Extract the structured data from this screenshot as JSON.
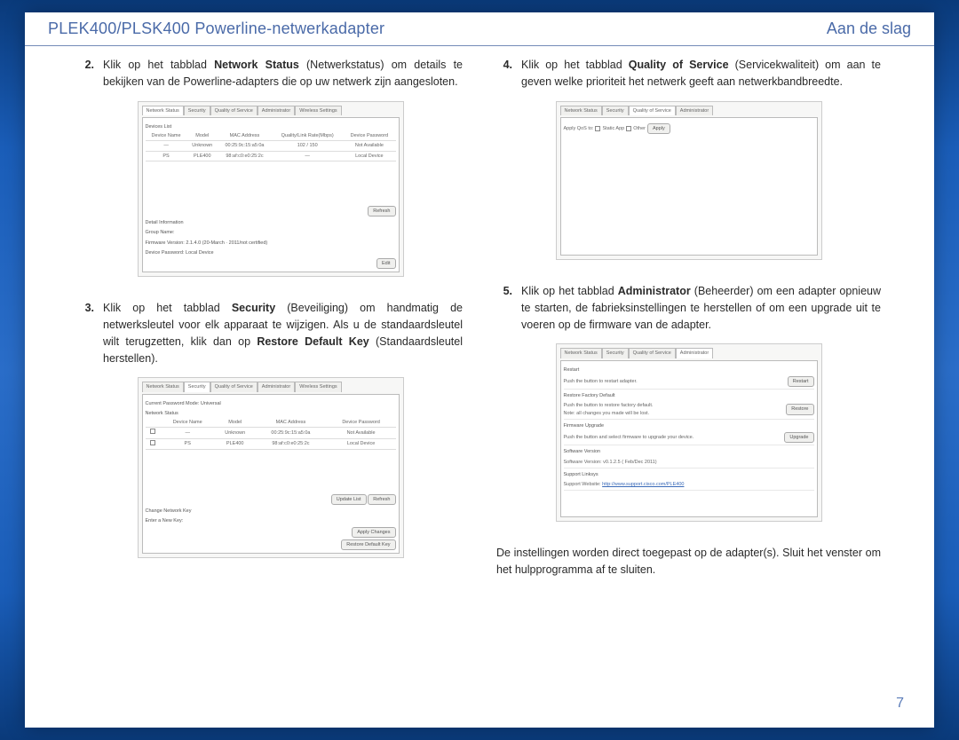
{
  "header": {
    "title": "PLEK400/PLSK400 Powerline-netwerkadapter",
    "section": "Aan de slag"
  },
  "page_number": "7",
  "steps": {
    "s2": {
      "num": "2.",
      "pre": "Klik op het tabblad ",
      "bold": "Network Status",
      "post": " (Netwerkstatus) om details te bekijken van de Powerline-adapters die op uw netwerk zijn aangesloten."
    },
    "s3": {
      "num": "3.",
      "pre": "Klik op het tabblad ",
      "bold": "Security",
      "mid": " (Beveiliging) om handmatig de netwerksleutel voor elk apparaat te wijzigen. Als u de standaardsleutel wilt terugzetten, klik dan op ",
      "bold2": "Restore Default Key",
      "post": " (Standaardsleutel herstellen)."
    },
    "s4": {
      "num": "4.",
      "pre": "Klik op het tabblad ",
      "bold": "Quality of Service",
      "post": " (Servicekwaliteit) om aan te geven welke prioriteit het netwerk geeft aan netwerkbandbreedte."
    },
    "s5": {
      "num": "5.",
      "pre": "Klik op het tabblad ",
      "bold": "Administrator",
      "post": " (Beheerder) om een adapter opnieuw te starten, de fabrieksinstellingen te herstellen of om een upgrade uit te voeren op de firmware van de adapter."
    }
  },
  "closing": "De instellingen worden direct toegepast op de adapter(s). Sluit het venster om het hulpprogramma af te sluiten.",
  "shots": {
    "common_tabs": [
      "Network Status",
      "Security",
      "Quality of Service",
      "Administrator",
      "Wireless Settings"
    ],
    "shot1": {
      "subtitle": "Devices List",
      "headers": [
        "Device Name",
        "Model",
        "MAC Address",
        "Quality/Link Rate(Mbps)",
        "Device Password"
      ],
      "rows": [
        [
          "—",
          "Unknown",
          "00:25:9c:15:a5:0a",
          "102 / 150",
          "Not Available"
        ],
        [
          "PS",
          "PLE400",
          "98:af:c0:e0:25:2c",
          "—",
          "Local Device"
        ]
      ],
      "refresh": "Refresh",
      "info_title": "Detail Information",
      "group": "Group Name:",
      "fw": "Firmware Version:   2.1.4.0 (20-March · 2011/not certified)",
      "pw": "Device Password:   Local Device",
      "edit": "Edit"
    },
    "shot3": {
      "cur": "Current Password Mode:   Universal",
      "status": "Network Status",
      "headers": [
        "",
        "Device Name",
        "Model",
        "MAC Address",
        "Device Password"
      ],
      "rows": [
        [
          "",
          "—",
          "Unknown",
          "00:25:9c:15:a5:0a",
          "Not Available"
        ],
        [
          "",
          "PS",
          "PLE400",
          "98:af:c0:e0:25:2c",
          "Local Device"
        ]
      ],
      "btns": {
        "update": "Update List",
        "refresh": "Refresh"
      },
      "change": "Change Network Key",
      "enter": "Enter a New Key:",
      "apply": "Apply Changes",
      "restore": "Restore Default Key"
    },
    "shot4": {
      "apply_qos": "Apply QoS to:",
      "opt1": "Static App",
      "opt2": "Other",
      "apply": "Apply"
    },
    "shot5": {
      "sections": {
        "restart": {
          "title": "Restart",
          "desc": "Push the button to restart adapter.",
          "btn": "Restart"
        },
        "factory": {
          "title": "Restore Factory Default",
          "desc": "Push the button to restore factory default.\nNote: all changes you made will be lost.",
          "btn": "Restore"
        },
        "fw": {
          "title": "Firmware Upgrade",
          "desc": "Push the button and select firmware to upgrade your device.",
          "btn": "Upgrade"
        },
        "ver": {
          "title": "Software Version",
          "desc": "Software Version:   v0.1.2.5 ( Feb/Dec 2011)"
        },
        "link": {
          "title": "Support Linksys",
          "label": "Support Website:",
          "url": "http://www.support.cisco.com/PLE400"
        }
      }
    }
  }
}
